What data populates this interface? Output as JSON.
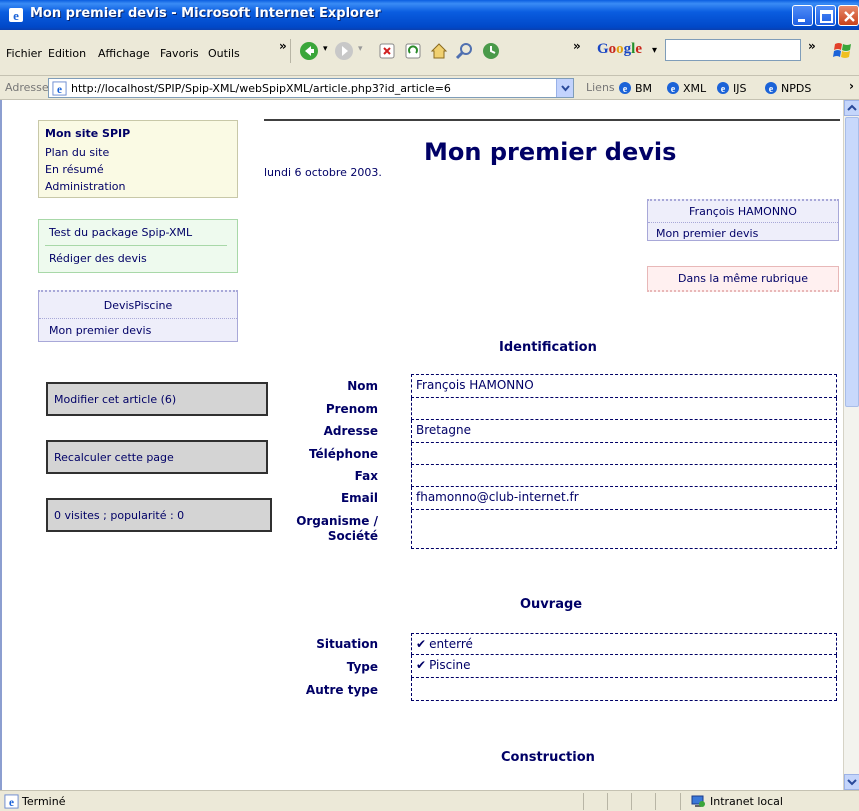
{
  "window": {
    "title": "Mon premier devis - Microsoft Internet Explorer"
  },
  "menu": {
    "items": [
      "Fichier",
      "Edition",
      "Affichage",
      "Favoris",
      "Outils"
    ],
    "chevron": "»"
  },
  "toolbar": {
    "google_label": "Google",
    "google_arrow": "▾",
    "chevron": "»"
  },
  "address": {
    "label": "Adresse",
    "url": "http://localhost/SPIP/Spip-XML/webSpipXML/article.php3?id_article=6",
    "links_label": "Liens",
    "links": [
      "BM",
      "XML",
      "IJS",
      "NPDS"
    ]
  },
  "sidebar": {
    "site": {
      "title": "Mon site SPIP",
      "links": [
        "Plan du site",
        "En résumé",
        "Administration"
      ]
    },
    "test": {
      "title": "Test du package Spip-XML",
      "link": "Rédiger des devis"
    },
    "rubrique": {
      "title": "DevisPiscine",
      "link": "Mon premier devis"
    },
    "actions": [
      "Modifier cet article (6)",
      "Recalculer cette page",
      "0 visites ; popularité : 0"
    ]
  },
  "article": {
    "title": "Mon premier devis",
    "date": "lundi 6 octobre 2003.",
    "author": {
      "name": "François HAMONNO",
      "link": "Mon premier devis"
    },
    "same_rubric": "Dans la même rubrique"
  },
  "sections": {
    "identification": {
      "title": "Identification",
      "fields": [
        {
          "label": "Nom",
          "value": "François HAMONNO"
        },
        {
          "label": "Prenom",
          "value": ""
        },
        {
          "label": "Adresse",
          "value": "Bretagne"
        },
        {
          "label": "Téléphone",
          "value": ""
        },
        {
          "label": "Fax",
          "value": ""
        },
        {
          "label": "Email",
          "value": "fhamonno@club-internet.fr"
        },
        {
          "label": "Organisme / Société",
          "value": ""
        }
      ]
    },
    "ouvrage": {
      "title": "Ouvrage",
      "fields": [
        {
          "label": "Situation",
          "value": "enterré",
          "check": "✔"
        },
        {
          "label": "Type",
          "value": "Piscine",
          "check": "✔"
        },
        {
          "label": "Autre type",
          "value": ""
        }
      ]
    },
    "construction": {
      "title": "Construction"
    }
  },
  "status": {
    "text": "Terminé",
    "zone": "Intranet local"
  }
}
